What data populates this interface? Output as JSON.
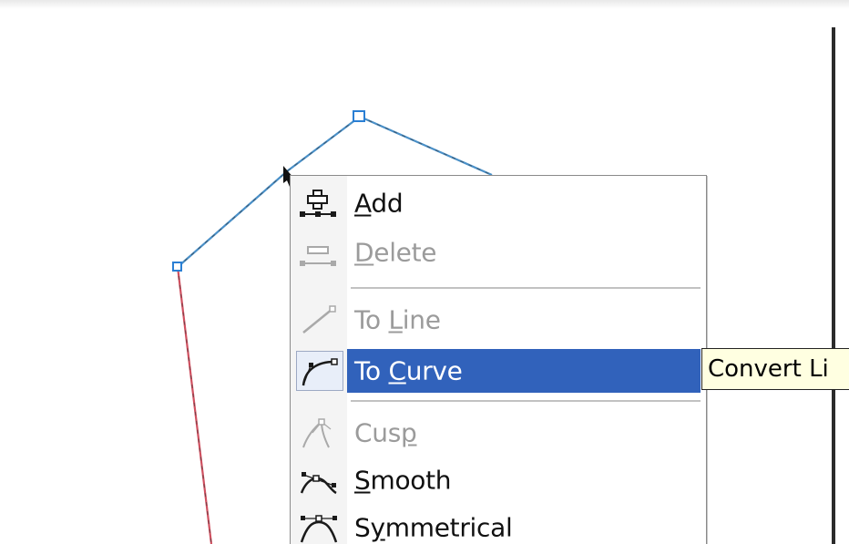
{
  "context_menu": {
    "items": [
      {
        "label_pre": "",
        "accel": "A",
        "label_post": "dd",
        "icon": "add-node-icon",
        "enabled": true
      },
      {
        "label_pre": "",
        "accel": "D",
        "label_post": "elete",
        "icon": "delete-node-icon",
        "enabled": false
      },
      {
        "label_pre": "To ",
        "accel": "L",
        "label_post": "ine",
        "icon": "to-line-icon",
        "enabled": false
      },
      {
        "label_pre": "To ",
        "accel": "C",
        "label_post": "urve",
        "icon": "to-curve-icon",
        "enabled": true,
        "highlighted": true
      },
      {
        "label_pre": "Cus",
        "accel": "p",
        "label_post": "",
        "icon": "cusp-icon",
        "enabled": false
      },
      {
        "label_pre": "",
        "accel": "S",
        "label_post": "mooth",
        "icon": "smooth-icon",
        "enabled": true
      },
      {
        "label_pre": "S",
        "accel": "y",
        "label_post": "mmetrical",
        "icon": "symmetrical-icon",
        "enabled": true
      }
    ]
  },
  "tooltip": {
    "text": "Convert Li"
  },
  "colors": {
    "highlight": "#3162bb",
    "path_segment": "#4a90c8",
    "path_selected": "#d05060",
    "node": "#2a7fd4",
    "tooltip_bg": "#ffffe1"
  }
}
